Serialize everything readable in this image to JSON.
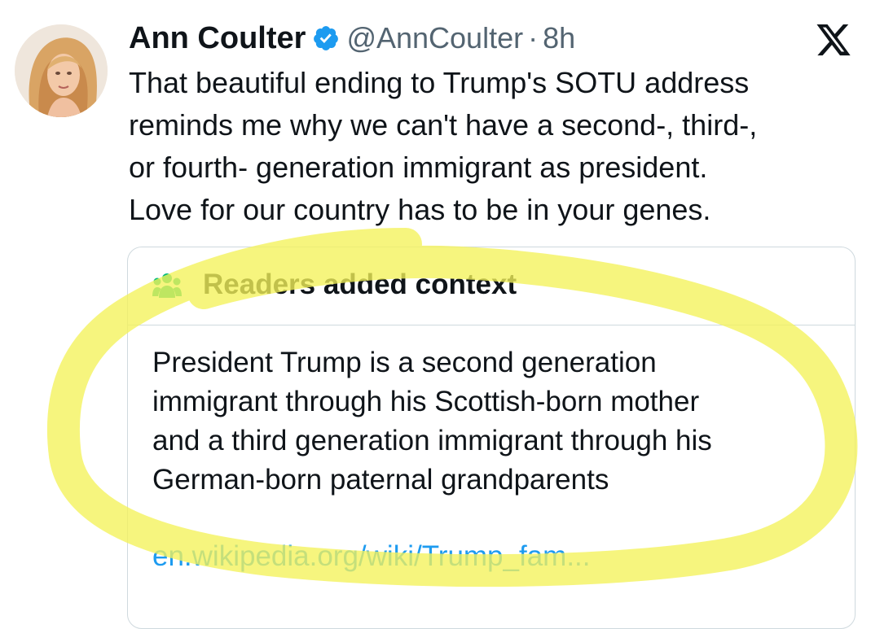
{
  "tweet": {
    "author_name": "Ann Coulter",
    "handle": "@AnnCoulter",
    "separator": "·",
    "time": "8h",
    "text_lines": [
      "That beautiful ending to Trump's SOTU address",
      "reminds me why we can't have a second-, third-,",
      "or fourth- generation immigrant as president.",
      "Love for our country has to be in your genes."
    ]
  },
  "context": {
    "title": "Readers added context",
    "body_lines": [
      "President Trump is a second generation",
      "immigrant through his Scottish-born mother",
      "and a third generation immigrant through his",
      "German-born paternal grandparents"
    ],
    "link_text": "en.wikipedia.org/wiki/Trump_fam..."
  },
  "icons": {
    "verified": "verified-badge-icon",
    "platform": "x-logo-icon",
    "community": "people-group-icon"
  },
  "colors": {
    "text": "#0f1419",
    "secondary_text": "#536471",
    "link": "#1d9bf0",
    "verified_badge": "#1d9bf0",
    "community_icon": "#00ba7c",
    "highlighter": "#f4f25a"
  }
}
